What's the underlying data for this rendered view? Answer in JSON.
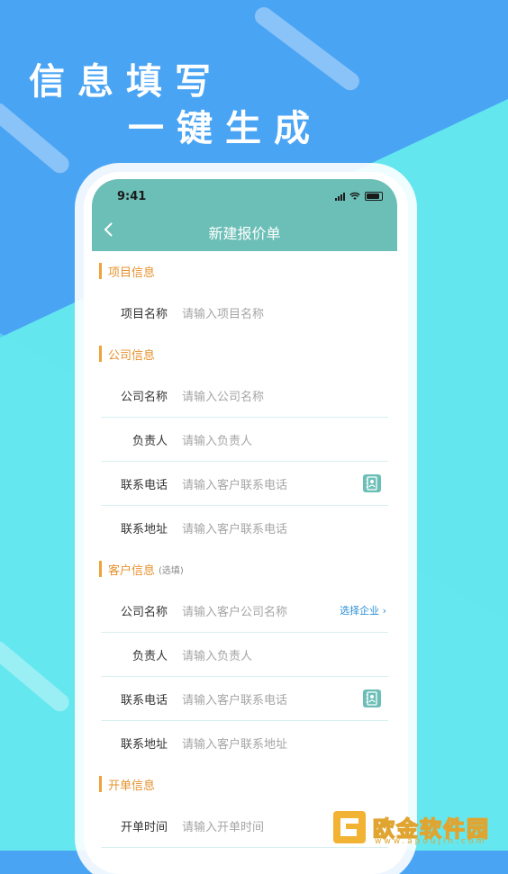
{
  "headline": {
    "line1": "信息填写",
    "line2": "一键生成"
  },
  "status": {
    "time": "9:41"
  },
  "nav": {
    "title": "新建报价单"
  },
  "sections": {
    "project": {
      "title": "项目信息"
    },
    "company": {
      "title": "公司信息"
    },
    "customer": {
      "title": "客户信息",
      "sub": "(选填)"
    },
    "order": {
      "title": "开单信息"
    }
  },
  "project_fields": [
    {
      "label": "项目名称",
      "placeholder": "请输入项目名称"
    }
  ],
  "company_fields": [
    {
      "label": "公司名称",
      "placeholder": "请输入公司名称"
    },
    {
      "label": "负责人",
      "placeholder": "请输入负责人"
    },
    {
      "label": "联系电话",
      "placeholder": "请输入客户联系电话"
    },
    {
      "label": "联系地址",
      "placeholder": "请输入客户联系电话"
    }
  ],
  "customer_fields": [
    {
      "label": "公司名称",
      "placeholder": "请输入客户公司名称",
      "link": "选择企业"
    },
    {
      "label": "负责人",
      "placeholder": "请输入负责人"
    },
    {
      "label": "联系电话",
      "placeholder": "请输入客户联系电话"
    },
    {
      "label": "联系地址",
      "placeholder": "请输入客户联系地址"
    }
  ],
  "order_fields": [
    {
      "label": "开单时间",
      "placeholder": "请输入开单时间"
    }
  ],
  "watermark": {
    "name": "欧金软件园",
    "url": "www.apoujin.com"
  },
  "colors": {
    "teal": "#6cbfb7",
    "orange": "#e7912c",
    "blue": "#4aa4f4",
    "cyan": "#64e6ee"
  },
  "icons": [
    "back-icon",
    "signal-icon",
    "wifi-icon",
    "battery-icon",
    "contact-book-icon",
    "chevron-right-icon"
  ]
}
